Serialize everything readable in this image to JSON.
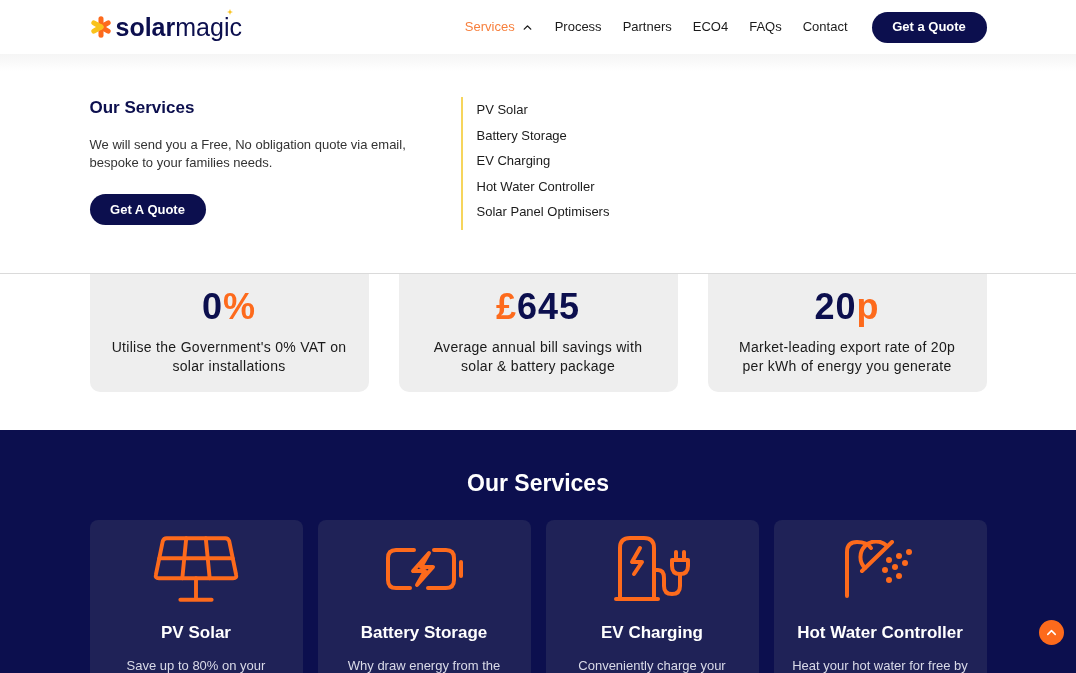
{
  "header": {
    "logo": {
      "text": "**solar**magic"
    },
    "nav": [
      {
        "label": "Services",
        "kind": "dropdown",
        "selected": true,
        "expanded": true
      },
      {
        "label": "Process",
        "kind": "link",
        "selected": false
      },
      {
        "label": "Partners",
        "kind": "link",
        "selected": false
      },
      {
        "label": "ECO4",
        "kind": "link",
        "selected": false
      },
      {
        "label": "FAQs",
        "kind": "link",
        "selected": false
      },
      {
        "label": "Contact",
        "kind": "link",
        "selected": false
      }
    ],
    "cta": "Get a Quote"
  },
  "services_menu": {
    "title": "Our Services",
    "description": "We will send you a Free, No obligation quote via email, bespoke to your families needs.",
    "button": "Get A Quote",
    "links": [
      "PV Solar",
      "Battery Storage",
      "EV Charging",
      "Hot Water Controller",
      "Solar Panel Optimisers"
    ]
  },
  "stats": [
    {
      "value": [
        {
          "text": "0",
          "accent": false
        },
        {
          "text": "%",
          "accent": true
        }
      ],
      "description": "Utilise the Government's 0% VAT on solar installations"
    },
    {
      "value": [
        {
          "text": "£",
          "accent": true
        },
        {
          "text": "645",
          "accent": false
        }
      ],
      "description": "Average annual bill savings with solar & battery package"
    },
    {
      "value": [
        {
          "text": "20",
          "accent": false
        },
        {
          "text": "p",
          "accent": true
        }
      ],
      "description": "Market-leading export rate of 20p per kWh of energy you generate"
    }
  ],
  "services": {
    "title": "Our Services",
    "cards": [
      {
        "kind": "solar-panel",
        "title": "PV Solar",
        "description": "Save up to 80% on your"
      },
      {
        "kind": "battery",
        "title": "Battery Storage",
        "description": "Why draw energy from the"
      },
      {
        "kind": "ev-charger",
        "title": "EV Charging",
        "description": "Conveniently charge your"
      },
      {
        "kind": "shower",
        "title": "Hot Water Controller",
        "description": "Heat your hot water for free by"
      }
    ]
  }
}
